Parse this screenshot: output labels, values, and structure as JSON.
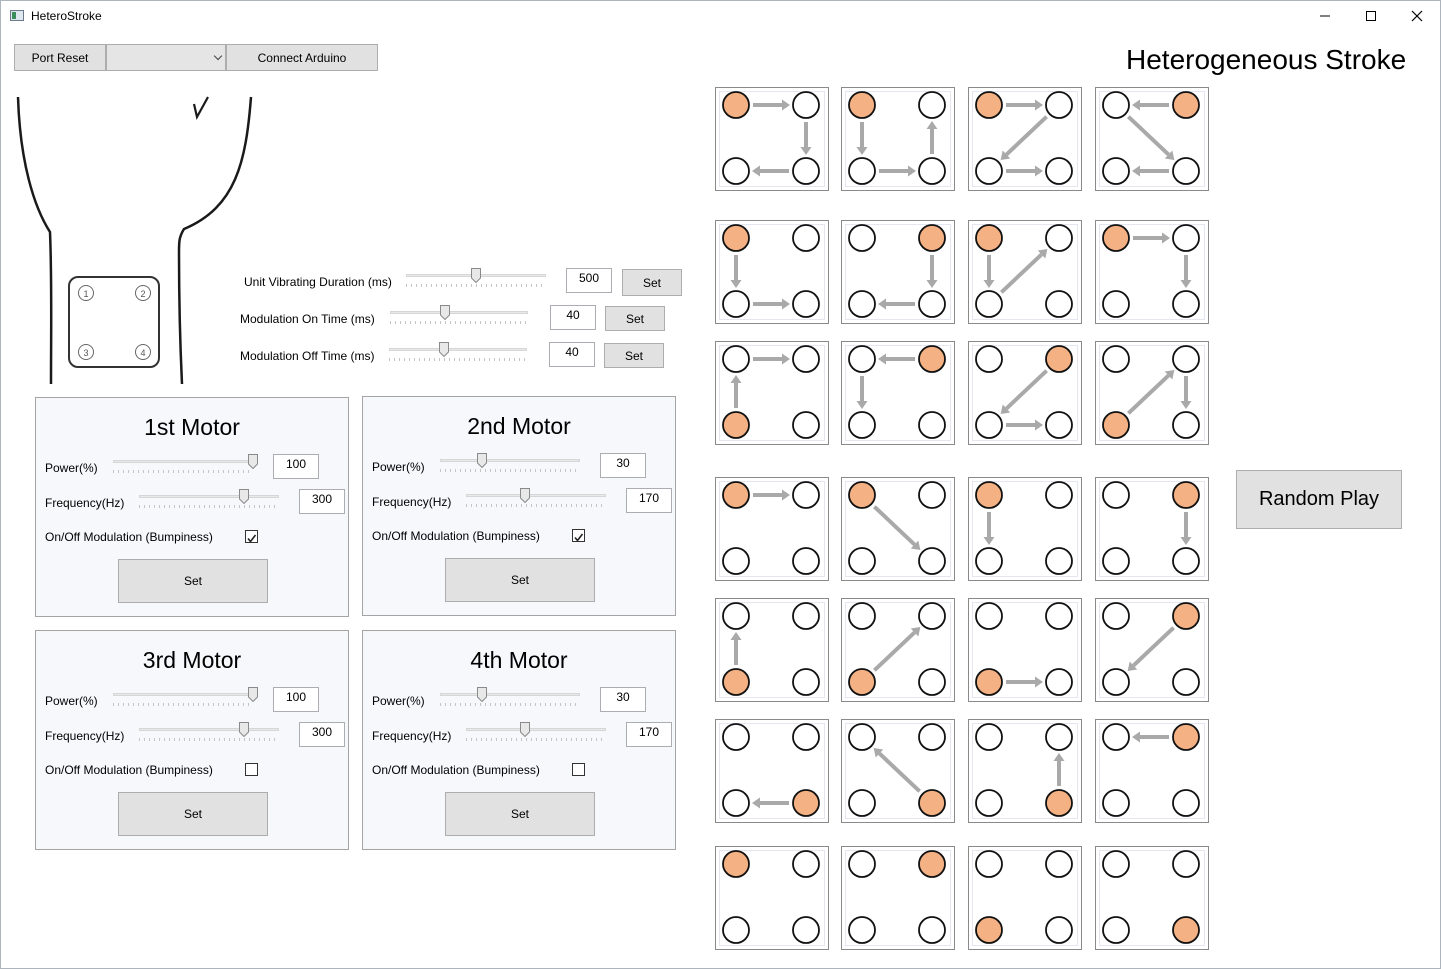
{
  "window": {
    "title": "HeteroStroke",
    "min_icon": "minimize-icon",
    "max_icon": "maximize-icon",
    "close_icon": "close-icon"
  },
  "toolbar": {
    "port_reset": "Port Reset",
    "port_select_value": "",
    "connect": "Connect Arduino"
  },
  "heading": "Heterogeneous Stroke",
  "motor_pad": {
    "labels": [
      "1",
      "2",
      "3",
      "4"
    ]
  },
  "timing": [
    {
      "label": "Unit Vibrating Duration (ms)",
      "value": "500",
      "set": "Set",
      "level": 0.5
    },
    {
      "label": "Modulation On Time (ms)",
      "value": "40",
      "set": "Set",
      "level": 0.4
    },
    {
      "label": "Modulation Off Time (ms)",
      "value": "40",
      "set": "Set",
      "level": 0.4
    }
  ],
  "motors": [
    {
      "title": "1st Motor",
      "power_label": "Power(%)",
      "power": "100",
      "power_level": 1.0,
      "freq_label": "Frequency(Hz)",
      "freq": "300",
      "freq_level": 0.75,
      "mod_label": "On/Off Modulation (Bumpiness)",
      "mod_checked": true,
      "set": "Set"
    },
    {
      "title": "2nd Motor",
      "power_label": "Power(%)",
      "power": "30",
      "power_level": 0.3,
      "freq_label": "Frequency(Hz)",
      "freq": "170",
      "freq_level": 0.42,
      "mod_label": "On/Off Modulation (Bumpiness)",
      "mod_checked": true,
      "set": "Set"
    },
    {
      "title": "3rd Motor",
      "power_label": "Power(%)",
      "power": "100",
      "power_level": 1.0,
      "freq_label": "Frequency(Hz)",
      "freq": "300",
      "freq_level": 0.75,
      "mod_label": "On/Off Modulation (Bumpiness)",
      "mod_checked": false,
      "set": "Set"
    },
    {
      "title": "4th Motor",
      "power_label": "Power(%)",
      "power": "30",
      "power_level": 0.3,
      "freq_label": "Frequency(Hz)",
      "freq": "170",
      "freq_level": 0.42,
      "mod_label": "On/Off Modulation (Bumpiness)",
      "mod_checked": false,
      "set": "Set"
    }
  ],
  "random_play": "Random Play",
  "colors": {
    "active": "#f4b183",
    "arrow": "#a9a9a9",
    "panel_bg": "#f7f8fc"
  },
  "patterns": [
    {
      "active": [
        1
      ],
      "arrows": [
        [
          1,
          2
        ],
        [
          2,
          4
        ],
        [
          4,
          3
        ]
      ]
    },
    {
      "active": [
        1
      ],
      "arrows": [
        [
          1,
          3
        ],
        [
          3,
          4
        ],
        [
          4,
          2
        ]
      ]
    },
    {
      "active": [
        1
      ],
      "arrows": [
        [
          1,
          2
        ],
        [
          2,
          3
        ],
        [
          3,
          4
        ]
      ]
    },
    {
      "active": [
        2
      ],
      "arrows": [
        [
          2,
          1
        ],
        [
          1,
          4
        ],
        [
          4,
          3
        ]
      ]
    },
    {
      "active": [
        1
      ],
      "arrows": [
        [
          1,
          3
        ],
        [
          3,
          4
        ]
      ]
    },
    {
      "active": [
        2
      ],
      "arrows": [
        [
          2,
          4
        ],
        [
          4,
          3
        ]
      ]
    },
    {
      "active": [
        1
      ],
      "arrows": [
        [
          1,
          3
        ],
        [
          3,
          2
        ]
      ]
    },
    {
      "active": [
        1
      ],
      "arrows": [
        [
          1,
          2
        ],
        [
          2,
          4
        ]
      ]
    },
    {
      "active": [
        3
      ],
      "arrows": [
        [
          3,
          1
        ],
        [
          1,
          2
        ]
      ]
    },
    {
      "active": [
        2
      ],
      "arrows": [
        [
          2,
          1
        ],
        [
          1,
          3
        ]
      ]
    },
    {
      "active": [
        2
      ],
      "arrows": [
        [
          2,
          3
        ],
        [
          3,
          4
        ]
      ]
    },
    {
      "active": [
        3
      ],
      "arrows": [
        [
          3,
          2
        ],
        [
          2,
          4
        ]
      ]
    },
    {
      "active": [
        1
      ],
      "arrows": [
        [
          1,
          2
        ]
      ]
    },
    {
      "active": [
        1
      ],
      "arrows": [
        [
          1,
          4
        ]
      ]
    },
    {
      "active": [
        1
      ],
      "arrows": [
        [
          1,
          3
        ]
      ]
    },
    {
      "active": [
        2
      ],
      "arrows": [
        [
          2,
          4
        ]
      ]
    },
    {
      "active": [
        3
      ],
      "arrows": [
        [
          3,
          1
        ]
      ]
    },
    {
      "active": [
        3
      ],
      "arrows": [
        [
          3,
          2
        ]
      ]
    },
    {
      "active": [
        3
      ],
      "arrows": [
        [
          3,
          4
        ]
      ]
    },
    {
      "active": [
        2
      ],
      "arrows": [
        [
          2,
          3
        ]
      ]
    },
    {
      "active": [
        4
      ],
      "arrows": [
        [
          4,
          3
        ]
      ]
    },
    {
      "active": [
        4
      ],
      "arrows": [
        [
          4,
          1
        ]
      ]
    },
    {
      "active": [
        4
      ],
      "arrows": [
        [
          4,
          2
        ]
      ]
    },
    {
      "active": [
        2
      ],
      "arrows": [
        [
          2,
          1
        ]
      ]
    },
    {
      "active": [
        1
      ],
      "arrows": []
    },
    {
      "active": [
        2
      ],
      "arrows": []
    },
    {
      "active": [
        3
      ],
      "arrows": []
    },
    {
      "active": [
        4
      ],
      "arrows": []
    }
  ]
}
